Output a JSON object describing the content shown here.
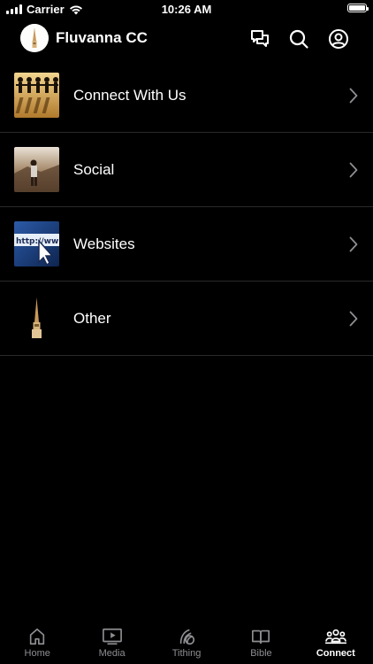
{
  "status_bar": {
    "carrier": "Carrier",
    "time": "10:26 AM"
  },
  "header": {
    "title": "Fluvanna CC",
    "icons": [
      "chat-icon",
      "search-icon",
      "profile-icon"
    ]
  },
  "list": {
    "items": [
      {
        "label": "Connect With Us",
        "thumb": "people-chain-image"
      },
      {
        "label": "Social",
        "thumb": "person-landscape-image"
      },
      {
        "label": "Websites",
        "thumb": "browser-cursor-image"
      },
      {
        "label": "Other",
        "thumb": "steeple-image"
      }
    ]
  },
  "tabbar": {
    "tabs": [
      {
        "label": "Home",
        "icon": "home-icon",
        "active": false
      },
      {
        "label": "Media",
        "icon": "media-icon",
        "active": false
      },
      {
        "label": "Tithing",
        "icon": "tithing-icon",
        "active": false
      },
      {
        "label": "Bible",
        "icon": "bible-icon",
        "active": false
      },
      {
        "label": "Connect",
        "icon": "connect-icon",
        "active": true
      }
    ]
  },
  "colors": {
    "background": "#000000",
    "text": "#ffffff",
    "inactive_tab": "#8e8e93",
    "divider": "#2a2a2a"
  }
}
